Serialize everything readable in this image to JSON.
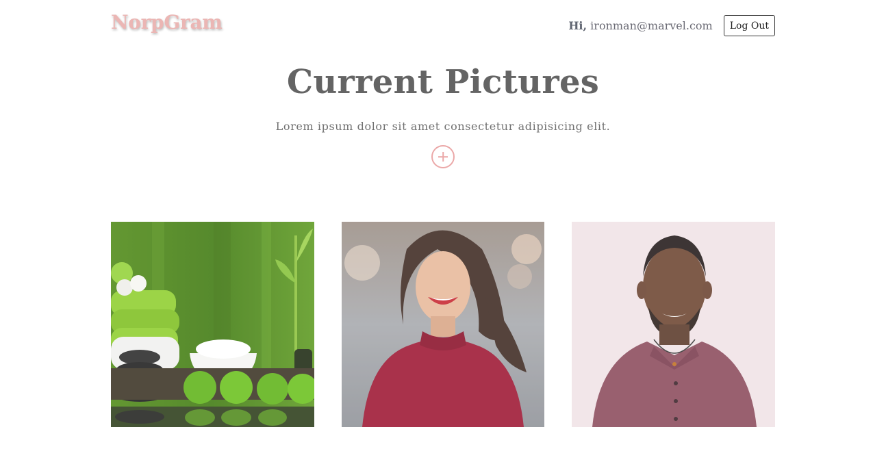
{
  "header": {
    "brand": "NorpGram",
    "greeting_prefix": "Hi,",
    "user_email": "ironman@marvel.com",
    "logout_label": "Log Out"
  },
  "hero": {
    "title": "Current Pictures",
    "subtitle": "Lorem ipsum dolor sit amet consectetur adipisicing elit.",
    "add_icon": "plus-circle-icon"
  },
  "gallery": {
    "pictures": [
      {
        "subject": "spa stones, towels and green flowers"
      },
      {
        "subject": "smiling woman in red sweater"
      },
      {
        "subject": "smiling man in maroon polo shirt"
      }
    ]
  },
  "colors": {
    "brand": "#ebb6b4",
    "accent": "#eba8a8",
    "title": "#646464",
    "text": "#717171"
  }
}
